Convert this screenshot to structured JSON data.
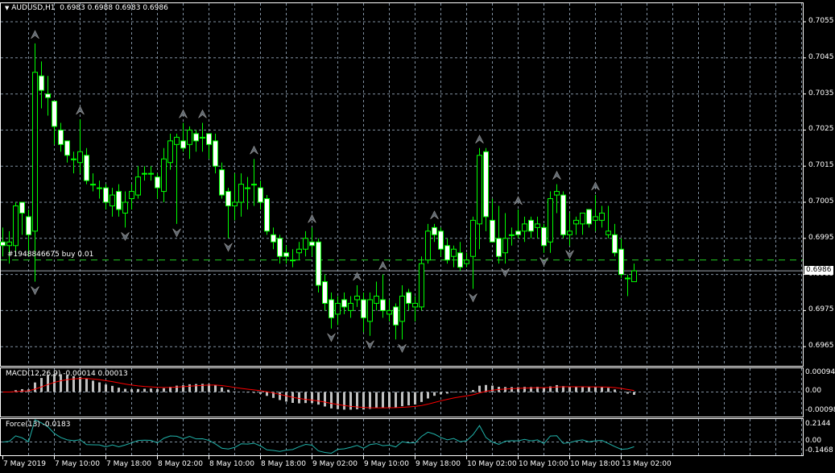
{
  "header": {
    "symbol": "AUDUSD,H1",
    "ohlc": "0.6983 0.6988 0.6983 0.6986",
    "menu_icon": "triangle-down-icon"
  },
  "order_line": {
    "label": "#1948846675 buy 0.01",
    "price": 0.6989
  },
  "bid_price": {
    "label": "0.6986",
    "value": 0.6986
  },
  "colors": {
    "background": "#000000",
    "candle": "#00ff00",
    "grid": "#8090a0",
    "order": "#22cc22",
    "macd_signal": "#ff0000",
    "macd_hist": "#c0c0c0",
    "force": "#20b2aa",
    "bid": "#a0a8b0"
  },
  "price_axis": [
    "0.7055",
    "0.7045",
    "0.7035",
    "0.7025",
    "0.7015",
    "0.7005",
    "0.6995",
    "0.6985",
    "0.6975",
    "0.6965"
  ],
  "macd": {
    "label": "MACD(12,26,9) -0.00014 0.00013",
    "axis": [
      "0.00094",
      "0.00",
      "-0.00098"
    ]
  },
  "force": {
    "label": "Force(13) -0.0183",
    "axis": [
      "0.2144",
      "0.00",
      "-0.1468"
    ]
  },
  "time_axis": [
    "7 May 2019",
    "7 May 10:00",
    "7 May 18:00",
    "8 May 02:00",
    "8 May 10:00",
    "8 May 18:00",
    "9 May 02:00",
    "9 May 10:00",
    "9 May 18:00",
    "10 May 02:00",
    "10 May 10:00",
    "10 May 18:00",
    "13 May 02:00"
  ],
  "chart_data": {
    "type": "candlestick",
    "title": "AUDUSD,H1",
    "ylim": [
      0.6961,
      0.7061
    ],
    "ohlc": [
      [
        0.6994,
        0.6998,
        0.699,
        0.6993
      ],
      [
        0.6993,
        0.6997,
        0.6988,
        0.6994
      ],
      [
        0.6993,
        0.7005,
        0.699,
        0.7004
      ],
      [
        0.7005,
        0.7005,
        0.6996,
        0.7002
      ],
      [
        0.7001,
        0.7003,
        0.699,
        0.6996
      ],
      [
        0.6997,
        0.7049,
        0.6983,
        0.7041
      ],
      [
        0.704,
        0.7044,
        0.7031,
        0.7036
      ],
      [
        0.7035,
        0.704,
        0.7029,
        0.7034
      ],
      [
        0.7033,
        0.7033,
        0.7021,
        0.7026
      ],
      [
        0.7025,
        0.7027,
        0.7019,
        0.7021
      ],
      [
        0.7022,
        0.7022,
        0.7016,
        0.7018
      ],
      [
        0.7017,
        0.7019,
        0.7013,
        0.7017
      ],
      [
        0.7016,
        0.7028,
        0.7013,
        0.7019
      ],
      [
        0.7018,
        0.702,
        0.701,
        0.7011
      ],
      [
        0.701,
        0.7013,
        0.7008,
        0.701
      ],
      [
        0.7009,
        0.7011,
        0.7006,
        0.7009
      ],
      [
        0.7009,
        0.701,
        0.7003,
        0.7005
      ],
      [
        0.7004,
        0.7009,
        0.7001,
        0.7007
      ],
      [
        0.7008,
        0.701,
        0.7001,
        0.7003
      ],
      [
        0.7002,
        0.7008,
        0.6998,
        0.7005
      ],
      [
        0.7006,
        0.701,
        0.7003,
        0.7008
      ],
      [
        0.7007,
        0.7015,
        0.7006,
        0.7012
      ],
      [
        0.7013,
        0.7015,
        0.7011,
        0.7013
      ],
      [
        0.7013,
        0.7015,
        0.7011,
        0.7013
      ],
      [
        0.7012,
        0.7013,
        0.7006,
        0.7009
      ],
      [
        0.7008,
        0.702,
        0.7005,
        0.7017
      ],
      [
        0.7016,
        0.7024,
        0.7014,
        0.7022
      ],
      [
        0.7021,
        0.7024,
        0.6999,
        0.7023
      ],
      [
        0.7022,
        0.7027,
        0.7019,
        0.702
      ],
      [
        0.7021,
        0.7026,
        0.7017,
        0.7025
      ],
      [
        0.7024,
        0.7025,
        0.7019,
        0.7022
      ],
      [
        0.7023,
        0.7027,
        0.7019,
        0.7023
      ],
      [
        0.7024,
        0.7024,
        0.7017,
        0.7021
      ],
      [
        0.7022,
        0.7024,
        0.7013,
        0.7015
      ],
      [
        0.7014,
        0.7016,
        0.7006,
        0.7007
      ],
      [
        0.7008,
        0.7009,
        0.6995,
        0.7004
      ],
      [
        0.7004,
        0.7013,
        0.7,
        0.7005
      ],
      [
        0.7005,
        0.7013,
        0.7001,
        0.701
      ],
      [
        0.7009,
        0.7012,
        0.7003,
        0.7009
      ],
      [
        0.701,
        0.7017,
        0.7004,
        0.701
      ],
      [
        0.7009,
        0.7011,
        0.7003,
        0.7005
      ],
      [
        0.7006,
        0.7007,
        0.6996,
        0.6997
      ],
      [
        0.6996,
        0.6998,
        0.6992,
        0.6994
      ],
      [
        0.6995,
        0.6996,
        0.6988,
        0.699
      ],
      [
        0.6991,
        0.6993,
        0.6988,
        0.699
      ],
      [
        0.6989,
        0.6992,
        0.6987,
        0.6989
      ],
      [
        0.6991,
        0.6994,
        0.6989,
        0.6992
      ],
      [
        0.6992,
        0.6997,
        0.699,
        0.6995
      ],
      [
        0.6994,
        0.6998,
        0.699,
        0.6993
      ],
      [
        0.6994,
        0.6995,
        0.698,
        0.6982
      ],
      [
        0.6983,
        0.6985,
        0.6975,
        0.6977
      ],
      [
        0.6978,
        0.698,
        0.697,
        0.6973
      ],
      [
        0.6974,
        0.6979,
        0.6971,
        0.6977
      ],
      [
        0.6978,
        0.698,
        0.6974,
        0.6976
      ],
      [
        0.6975,
        0.6979,
        0.6973,
        0.6977
      ],
      [
        0.6978,
        0.6982,
        0.6976,
        0.6979
      ],
      [
        0.6978,
        0.698,
        0.6969,
        0.6973
      ],
      [
        0.6972,
        0.698,
        0.6968,
        0.6978
      ],
      [
        0.6977,
        0.6983,
        0.6975,
        0.6979
      ],
      [
        0.6978,
        0.6985,
        0.6973,
        0.6975
      ],
      [
        0.6974,
        0.6978,
        0.6972,
        0.6975
      ],
      [
        0.6976,
        0.6977,
        0.6967,
        0.6971
      ],
      [
        0.6972,
        0.6982,
        0.6967,
        0.6979
      ],
      [
        0.698,
        0.6981,
        0.6975,
        0.6977
      ],
      [
        0.6976,
        0.6979,
        0.6972,
        0.6977
      ],
      [
        0.6976,
        0.699,
        0.6975,
        0.6988
      ],
      [
        0.6989,
        0.6999,
        0.6988,
        0.6997
      ],
      [
        0.6998,
        0.6999,
        0.6994,
        0.6996
      ],
      [
        0.6997,
        0.6998,
        0.699,
        0.6992
      ],
      [
        0.6993,
        0.6995,
        0.6988,
        0.6989
      ],
      [
        0.699,
        0.6993,
        0.6987,
        0.6992
      ],
      [
        0.6991,
        0.6994,
        0.6986,
        0.6987
      ],
      [
        0.6988,
        0.6991,
        0.6987,
        0.6989
      ],
      [
        0.699,
        0.7001,
        0.6981,
        0.7
      ],
      [
        0.6999,
        0.702,
        0.6992,
        0.7018
      ],
      [
        0.7019,
        0.702,
        0.6997,
        0.7001
      ],
      [
        0.7,
        0.7006,
        0.6994,
        0.6994
      ],
      [
        0.6995,
        0.7004,
        0.6988,
        0.699
      ],
      [
        0.6991,
        0.7002,
        0.6988,
        0.6995
      ],
      [
        0.6996,
        0.6998,
        0.6993,
        0.6996
      ],
      [
        0.6997,
        0.7003,
        0.6995,
        0.6996
      ],
      [
        0.6997,
        0.7001,
        0.6994,
        0.6999
      ],
      [
        0.7,
        0.7001,
        0.6995,
        0.6997
      ],
      [
        0.6998,
        0.7001,
        0.6995,
        0.6999
      ],
      [
        0.6998,
        0.6999,
        0.6991,
        0.6993
      ],
      [
        0.6994,
        0.7008,
        0.6991,
        0.7006
      ],
      [
        0.7007,
        0.701,
        0.7002,
        0.7008
      ],
      [
        0.7007,
        0.7008,
        0.6995,
        0.6996
      ],
      [
        0.6996,
        0.7002,
        0.6993,
        0.6997
      ],
      [
        0.6999,
        0.7001,
        0.6996,
        0.7
      ],
      [
        0.6999,
        0.7002,
        0.6996,
        0.7002
      ],
      [
        0.7003,
        0.7003,
        0.6998,
        0.6999
      ],
      [
        0.7,
        0.7007,
        0.6997,
        0.7001
      ],
      [
        0.7,
        0.7004,
        0.6998,
        0.7002
      ],
      [
        0.6996,
        0.7004,
        0.6995,
        0.6997
      ],
      [
        0.6996,
        0.6999,
        0.699,
        0.6991
      ],
      [
        0.6992,
        0.6995,
        0.6984,
        0.6985
      ],
      [
        0.6984,
        0.6985,
        0.6979,
        0.6984
      ],
      [
        0.6983,
        0.6988,
        0.6983,
        0.6986
      ]
    ],
    "fractals_up": [
      5,
      12,
      28,
      31,
      39,
      48,
      55,
      59,
      67,
      74,
      80,
      86,
      92
    ],
    "fractals_down": [
      5,
      19,
      27,
      35,
      51,
      57,
      62,
      73,
      78,
      84,
      88
    ]
  }
}
